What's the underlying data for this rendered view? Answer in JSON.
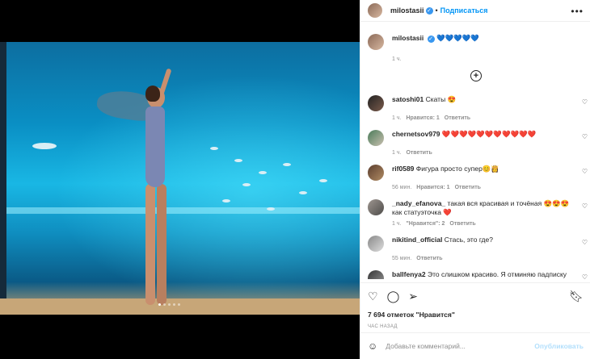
{
  "post": {
    "username": "milostasii",
    "verified_icon": "verified-badge-icon",
    "follow_label": "Подписаться",
    "more_icon": "more-options-icon",
    "caption_text": "💙💙💙💙💙",
    "caption_time": "1 ч.",
    "load_more_icon": "plus-circle-icon"
  },
  "comments": [
    {
      "username": "satoshi01",
      "text": "Скаты 😍",
      "time": "1 ч.",
      "likes": "Нравится: 1",
      "reply": "Ответить"
    },
    {
      "username": "chernetsov979",
      "text": "❤️❤️❤️❤️❤️❤️❤️❤️❤️❤️❤️",
      "time": "1 ч.",
      "likes": "",
      "reply": "Ответить"
    },
    {
      "username": "rif0589",
      "text": "Фигура просто супер😊👸",
      "time": "56 мин.",
      "likes": "Нравится: 1",
      "reply": "Ответить"
    },
    {
      "username": "_nady_efanova_",
      "text": "такая вся красивая и точёная 😍😍😍 как статуэточка ❤️",
      "time": "1 ч.",
      "likes": "\"Нравится\": 2",
      "reply": "Ответить"
    },
    {
      "username": "nikitind_official",
      "text": "Стась, это где?",
      "time": "55 мин.",
      "likes": "",
      "reply": "Ответить"
    },
    {
      "username": "ballfenya2",
      "text": "Это слишком красиво. Я отминяю падписку",
      "time": "",
      "likes": "",
      "reply": ""
    }
  ],
  "actions": {
    "like_icon": "heart-icon",
    "comment_icon": "comment-icon",
    "share_icon": "share-icon",
    "save_icon": "bookmark-icon",
    "likes_count": "7 694 отметок \"Нравится\"",
    "posted_ago": "ЧАС НАЗАД"
  },
  "composer": {
    "emoji_icon": "emoji-icon",
    "placeholder": "Добавьте комментарий...",
    "post_label": "Опубликовать"
  },
  "media": {
    "slides_total": 5,
    "slide_active": 1
  }
}
